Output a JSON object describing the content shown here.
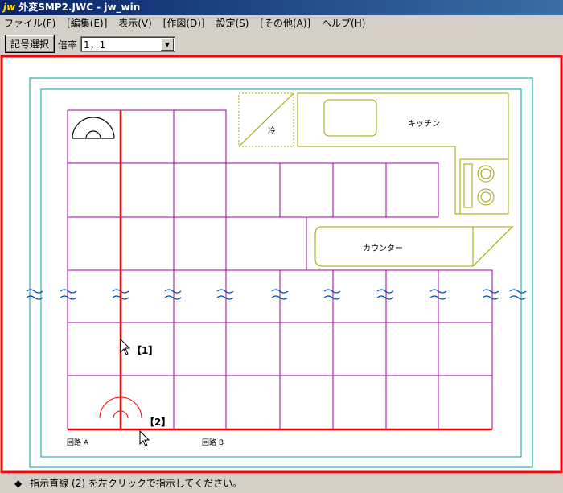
{
  "window": {
    "logo": "jw",
    "title": "外変SMP2.JWC - jw_win"
  },
  "menu": [
    "ファイル(F)",
    "[編集(E)]",
    "表示(V)",
    "[作図(D)]",
    "設定(S)",
    "[その他(A)]",
    "ヘルプ(H)"
  ],
  "toolbar": {
    "symbol_select_label": "記号選択",
    "rate_label": "倍率",
    "rate_value": "1，1"
  },
  "drawing": {
    "labels": {
      "kitchen": "キッチン",
      "counter": "カウンター",
      "refrigerator": "冷",
      "marker1": "【1】",
      "marker2": "【2】",
      "circuit_a": "回路 A",
      "circuit_b": "回路 B"
    },
    "colors": {
      "frame": "#ff0000",
      "border": "#00a0a0",
      "grid": "#a000a0",
      "fixtures": "#a0a000",
      "circuit": "#ff0000"
    }
  },
  "status": {
    "icon": "diamond-icon",
    "text": "指示直線 (2) を左クリックで指示してください。"
  }
}
